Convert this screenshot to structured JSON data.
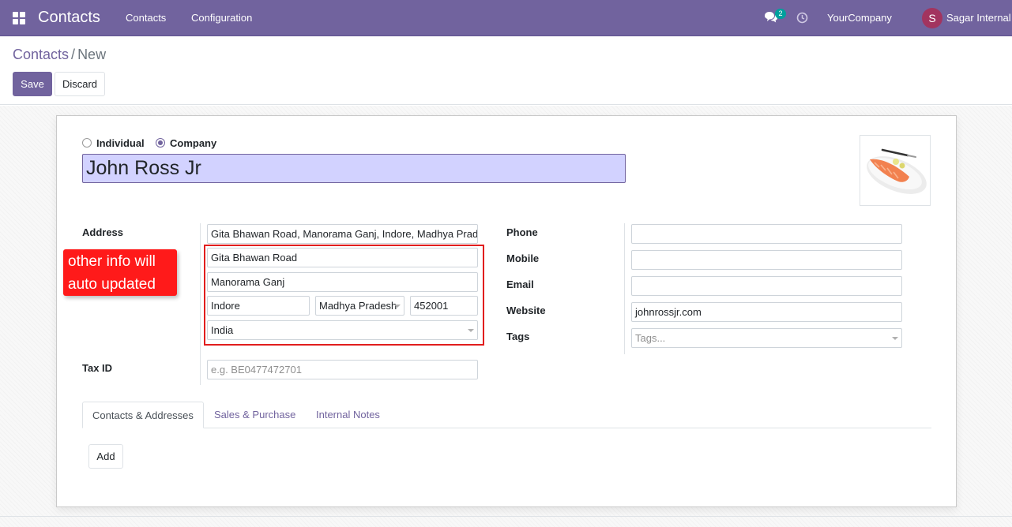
{
  "navbar": {
    "app_name": "Contacts",
    "menu": [
      "Contacts",
      "Configuration"
    ],
    "messages_badge": "2",
    "company": "YourCompany",
    "user_initial": "S",
    "user_name": "Sagar Internal",
    "accent_color": "#71639e"
  },
  "breadcrumb": {
    "parent": "Contacts",
    "separator": "/",
    "current": "New"
  },
  "actions": {
    "save": "Save",
    "discard": "Discard"
  },
  "form": {
    "type_options": [
      "Individual",
      "Company"
    ],
    "type_selected": "Company",
    "name": "John Ross Jr",
    "address": {
      "label": "Address",
      "full": "Gita Bhawan Road, Manorama Ganj, Indore, Madhya Pradesh",
      "street": "Gita Bhawan Road",
      "street2": "Manorama Ganj",
      "city": "Indore",
      "state": "Madhya Pradesh",
      "zip": "452001",
      "country": "India"
    },
    "tax_id": {
      "label": "Tax ID",
      "placeholder": "e.g. BE0477472701"
    },
    "phone": {
      "label": "Phone",
      "value": ""
    },
    "mobile": {
      "label": "Mobile",
      "value": ""
    },
    "email": {
      "label": "Email",
      "value": ""
    },
    "website": {
      "label": "Website",
      "value": "johnrossjr.com"
    },
    "tags": {
      "label": "Tags",
      "placeholder": "Tags..."
    }
  },
  "annotation": {
    "callout": "other info will auto updated",
    "color": "#ff1a1a"
  },
  "tabs": [
    "Contacts & Addresses",
    "Sales & Purchase",
    "Internal Notes"
  ],
  "tab_active": "Contacts & Addresses",
  "tab_content": {
    "add_label": "Add"
  }
}
